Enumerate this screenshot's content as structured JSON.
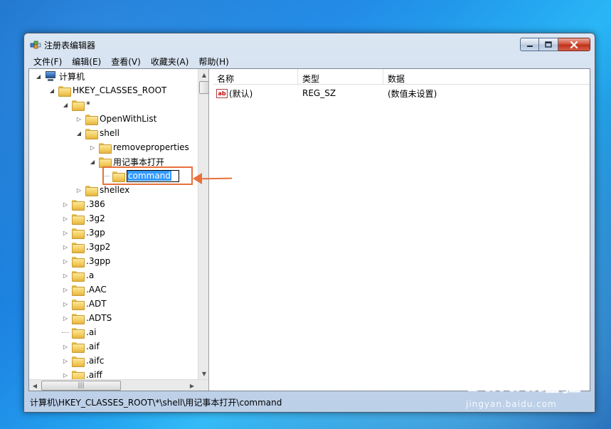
{
  "window": {
    "title": "注册表编辑器"
  },
  "menu": [
    "文件(F)",
    "编辑(E)",
    "查看(V)",
    "收藏夹(A)",
    "帮助(H)"
  ],
  "tree": {
    "items": [
      {
        "label": "计算机",
        "level": 0,
        "expander": "expanded",
        "icon": "computer"
      },
      {
        "label": "HKEY_CLASSES_ROOT",
        "level": 1,
        "expander": "expanded",
        "icon": "folder"
      },
      {
        "label": "*",
        "level": 2,
        "expander": "expanded",
        "icon": "folder"
      },
      {
        "label": "OpenWithList",
        "level": 3,
        "expander": "collapsed",
        "icon": "folder"
      },
      {
        "label": "shell",
        "level": 3,
        "expander": "expanded",
        "icon": "folder"
      },
      {
        "label": "removeproperties",
        "level": 4,
        "expander": "collapsed",
        "icon": "folder"
      },
      {
        "label": "用记事本打开",
        "level": 4,
        "expander": "expanded",
        "icon": "folder"
      },
      {
        "label": "command",
        "level": 5,
        "expander": "leaf",
        "icon": "folder",
        "editing": true
      },
      {
        "label": "shellex",
        "level": 3,
        "expander": "collapsed",
        "icon": "folder"
      },
      {
        "label": ".386",
        "level": 2,
        "expander": "collapsed",
        "icon": "folder"
      },
      {
        "label": ".3g2",
        "level": 2,
        "expander": "collapsed",
        "icon": "folder"
      },
      {
        "label": ".3gp",
        "level": 2,
        "expander": "collapsed",
        "icon": "folder"
      },
      {
        "label": ".3gp2",
        "level": 2,
        "expander": "collapsed",
        "icon": "folder"
      },
      {
        "label": ".3gpp",
        "level": 2,
        "expander": "collapsed",
        "icon": "folder"
      },
      {
        "label": ".a",
        "level": 2,
        "expander": "collapsed",
        "icon": "folder"
      },
      {
        "label": ".AAC",
        "level": 2,
        "expander": "collapsed",
        "icon": "folder"
      },
      {
        "label": ".ADT",
        "level": 2,
        "expander": "collapsed",
        "icon": "folder"
      },
      {
        "label": ".ADTS",
        "level": 2,
        "expander": "collapsed",
        "icon": "folder"
      },
      {
        "label": ".ai",
        "level": 2,
        "expander": "leaf",
        "icon": "folder"
      },
      {
        "label": ".aif",
        "level": 2,
        "expander": "collapsed",
        "icon": "folder"
      },
      {
        "label": ".aifc",
        "level": 2,
        "expander": "collapsed",
        "icon": "folder"
      },
      {
        "label": ".aiff",
        "level": 2,
        "expander": "collapsed",
        "icon": "folder"
      }
    ]
  },
  "list": {
    "columns": {
      "name": "名称",
      "type": "类型",
      "data": "数据"
    },
    "rows": [
      {
        "name": "(默认)",
        "type": "REG_SZ",
        "data": "(数值未设置)"
      }
    ]
  },
  "status": {
    "path": "计算机\\HKEY_CLASSES_ROOT\\*\\shell\\用记事本打开\\command"
  },
  "watermark": {
    "logo": "Baidu经验",
    "url": "jingyan.baidu.com"
  },
  "icons": {
    "app": "regedit-icon",
    "minimize": "minimize-icon",
    "maximize": "maximize-icon",
    "close": "close-icon",
    "value": "string-value-icon"
  },
  "colors": {
    "annotation": "#e8703a",
    "selection": "#3399ff"
  }
}
